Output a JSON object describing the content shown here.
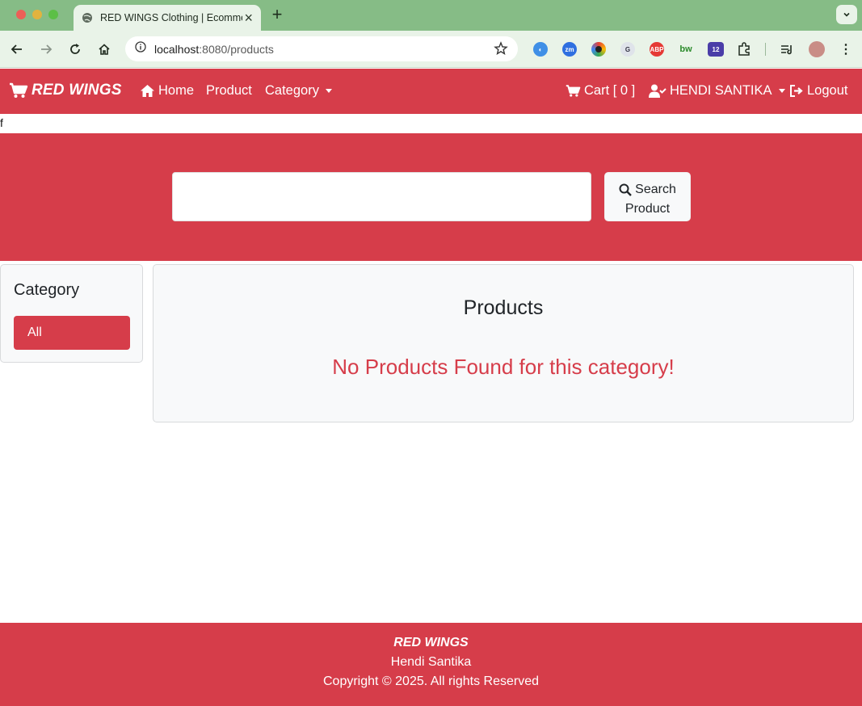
{
  "browser": {
    "tab_title": "RED WINGS Clothing | Ecommerce",
    "url_host": "localhost",
    "url_rest": ":8080/products",
    "extension_badge": "12"
  },
  "navbar": {
    "brand": "RED WINGS",
    "home": "Home",
    "product": "Product",
    "category": "Category",
    "cart": "Cart [ 0 ]",
    "user": "HENDI SANTIKA",
    "logout": "Logout"
  },
  "stray_text": "f",
  "search": {
    "input_value": "",
    "button_line1": "Search",
    "button_line2": "Product"
  },
  "sidebar": {
    "title": "Category",
    "items": [
      {
        "label": "All"
      }
    ]
  },
  "products": {
    "title": "Products",
    "empty_message": "No Products Found for this category!"
  },
  "footer": {
    "brand": "RED WINGS",
    "author": "Hendi Santika",
    "copyright": "Copyright © 2025. All rights Reserved"
  },
  "colors": {
    "accent": "#d63d4a",
    "chrome": "#86bc86"
  },
  "icons": {
    "brand": "cart-icon",
    "home": "home-icon",
    "cart": "cart-icon",
    "user": "user-check-icon",
    "logout": "logout-icon",
    "search": "search-icon"
  }
}
